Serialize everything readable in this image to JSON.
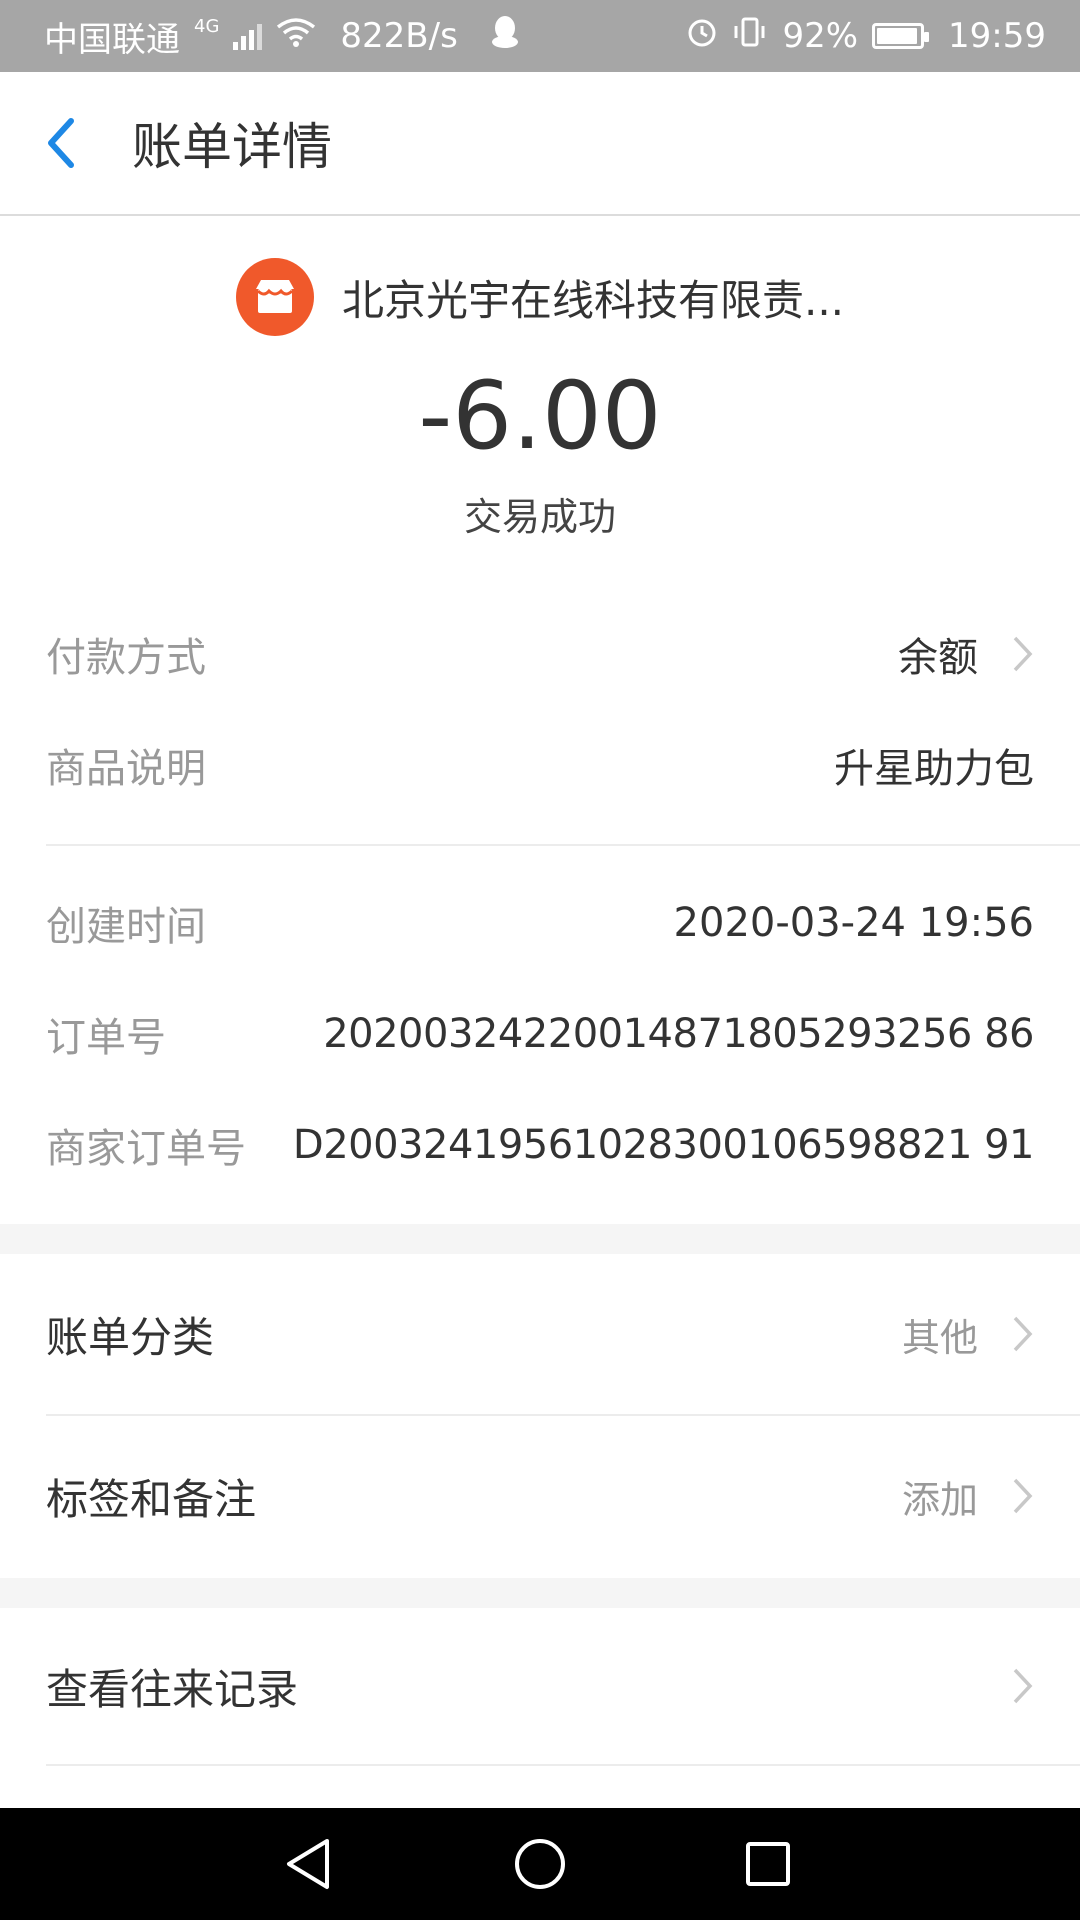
{
  "status_bar": {
    "carrier": "中国联通",
    "network": "4G",
    "speed": "822B/s",
    "battery": "92%",
    "time": "19:59"
  },
  "header": {
    "title": "账单详情"
  },
  "merchant": {
    "name": "北京光宇在线科技有限责...",
    "icon": "store-icon",
    "icon_color": "#f0592b"
  },
  "amount": "-6.00",
  "status": "交易成功",
  "details": [
    {
      "label": "付款方式",
      "value": "余额",
      "has_chevron": true
    },
    {
      "label": "商品说明",
      "value": "升星助力包",
      "has_chevron": false
    },
    {
      "label": "创建时间",
      "value": "2020-03-24 19:56",
      "has_chevron": false
    },
    {
      "label": "订单号",
      "value": "20200324220014871805293256 86",
      "has_chevron": false
    },
    {
      "label": "商家订单号",
      "value": "D20032419561028300106598821 91",
      "has_chevron": false
    }
  ],
  "actions": [
    {
      "label": "账单分类",
      "value": "其他"
    },
    {
      "label": "标签和备注",
      "value": "添加"
    },
    {
      "label": "查看往来记录",
      "value": ""
    }
  ],
  "nav": {
    "back": "back-triangle-icon",
    "home": "home-circle-icon",
    "recents": "recents-square-icon"
  }
}
